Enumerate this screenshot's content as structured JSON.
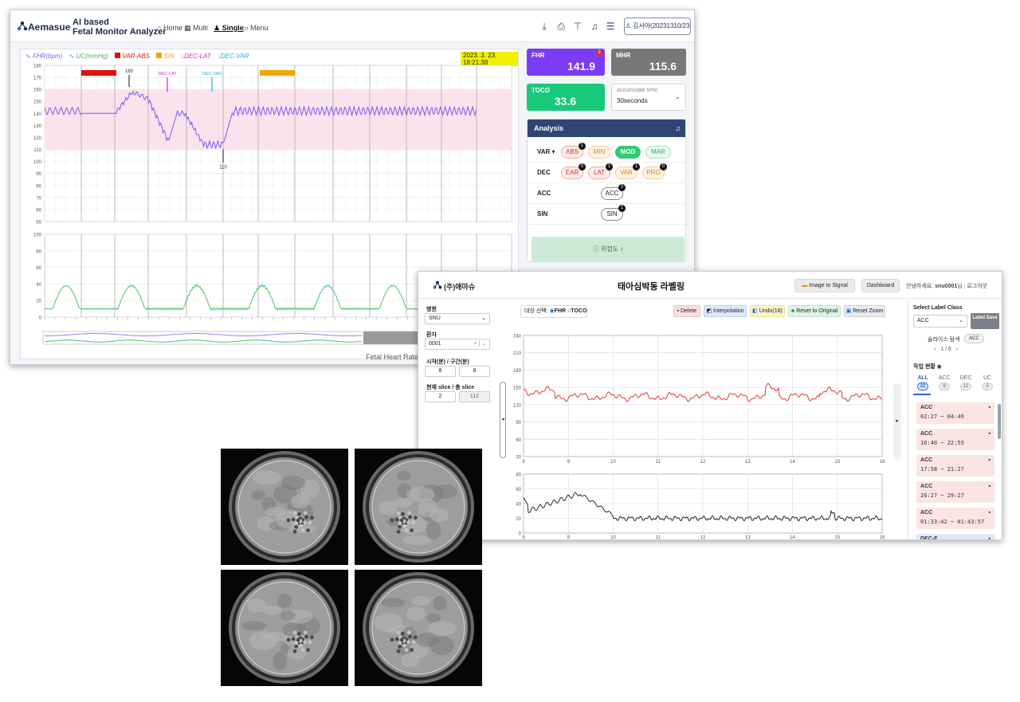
{
  "win1": {
    "brand": "Aemasue",
    "title_line1": "AI based",
    "title_line2": "Fetal Monitor Analyzer",
    "nav": [
      "Home",
      "Multi",
      "Single",
      "Menu"
    ],
    "user": "김서아(20231310/23",
    "legend": {
      "fhr": "FHR(bpm)",
      "uc": "UC(mmHg)",
      "var_abs": "VAR-ABS",
      "sin": "SIN",
      "dec_lat": "DEC-LAT",
      "dec_var": "DEC-VAR"
    },
    "datetime": "2023. 3. 23. 18:21:38",
    "fhr_chart": {
      "y_ticks": [
        "180",
        "170",
        "160",
        "150",
        "140",
        "130",
        "120",
        "110",
        "100",
        "90",
        "80",
        "70",
        "60",
        "50"
      ],
      "annotations": [
        "160",
        "DEC-LAT",
        "DEC-VAR",
        "110"
      ]
    },
    "uc_chart": {
      "y_ticks": [
        "100",
        "80",
        "60",
        "40",
        "20",
        "0"
      ]
    },
    "vitals": {
      "fhr_label": "FHR",
      "fhr_value": "141.9",
      "fhr_badge": "2",
      "mhr_label": "MHR",
      "mhr_value": "115.6",
      "toco_label": "TOCO",
      "toco_value": "33.6",
      "accumulate_label": "accumulate time",
      "accumulate_value": "30seconds"
    },
    "analysis": {
      "title": "Analysis",
      "rows": [
        {
          "key": "VAR",
          "pills": [
            {
              "label": "ABS",
              "badge": "1"
            },
            {
              "label": "MIN",
              "badge": ""
            },
            {
              "label": "MOD",
              "badge": ""
            },
            {
              "label": "MAR",
              "badge": ""
            }
          ]
        },
        {
          "key": "DEC",
          "pills": [
            {
              "label": "EAR",
              "badge": "0"
            },
            {
              "label": "LAT",
              "badge": "1"
            },
            {
              "label": "VAR",
              "badge": "1"
            },
            {
              "label": "PRO",
              "badge": "0"
            }
          ]
        },
        {
          "key": "ACC",
          "pills": [
            {
              "label": "ACC",
              "badge": "0"
            }
          ]
        },
        {
          "key": "SIN",
          "pills": [
            {
              "label": "SIN",
              "badge": "1"
            }
          ]
        }
      ],
      "risk_button": "ⓘ 위험도 ↕"
    },
    "footer": "Fetal Heart Rate"
  },
  "win2": {
    "logo": "(주)애마슈",
    "title": "태아심박동 라벨링",
    "buttons": {
      "image_to_signal": "Image to Signal",
      "dashboard": "Dashboard"
    },
    "greeting_prefix": "안녕하세요,",
    "greeting_user": "snu0001",
    "greeting_suffix": "님",
    "logout": "로그아웃",
    "sidebar": {
      "hospital_label": "병원",
      "hospital_value": "SNU",
      "patient_label": "환자",
      "patient_value": "0001",
      "start_label": "시작(분) / 구간(분)",
      "start_value": "8",
      "range_value": "8",
      "slice_label": "현재 slice / 총 slice",
      "slice_current": "2",
      "slice_total": "112"
    },
    "target": {
      "label": "대상 선택:",
      "opt1": "FHR",
      "opt2": "TOCO"
    },
    "actions": {
      "delete": "Delete",
      "interpolation": "Interpolation",
      "undo": "Undo(18)",
      "reset_original": "Reset to Original",
      "reset_zoom": "Reset Zoom"
    },
    "fhr_chart": {
      "y_ticks": [
        "240",
        "210",
        "180",
        "150",
        "120",
        "90",
        "60",
        "30"
      ],
      "x_ticks": [
        "8",
        "9",
        "10",
        "11",
        "12",
        "13",
        "14",
        "15",
        "16"
      ]
    },
    "toco_chart": {
      "y_ticks": [
        "80",
        "60",
        "40",
        "20",
        "0"
      ],
      "x_ticks": [
        "8",
        "9",
        "10",
        "11",
        "12",
        "13",
        "14",
        "15",
        "16"
      ]
    },
    "right": {
      "select_label": "Select Label Class",
      "select_value": "ACC",
      "label_save": "Label Save",
      "slice_search": "슬라이스 탐색",
      "slice_tag": "ACC",
      "pager": "1 / 6",
      "work_status": "작업 현황",
      "tabs": [
        {
          "label": "ALL",
          "count": "22"
        },
        {
          "label": "ACC",
          "count": "8"
        },
        {
          "label": "DEC",
          "count": "11"
        },
        {
          "label": "UC",
          "count": "3"
        }
      ],
      "cards": [
        {
          "type": "ACC",
          "range": "02:27 ~ 04:49"
        },
        {
          "type": "ACC",
          "range": "16:40 ~ 22:55"
        },
        {
          "type": "ACC",
          "range": "17:58 ~ 21:27"
        },
        {
          "type": "ACC",
          "range": "26:27 ~ 29:27"
        },
        {
          "type": "ACC",
          "range": "01:33:42 ~ 01:43:57"
        },
        {
          "type": "DEC-E",
          "range": ""
        }
      ]
    }
  },
  "colors": {
    "fhr": "#7a5cf0",
    "uc": "#4cc36a",
    "fhr2": "#e02020",
    "toco": "#111111",
    "navy": "#2f4574",
    "fhr_card": "#7b3cf5",
    "mhr_card": "#777777",
    "toco_card": "#19c97a"
  }
}
